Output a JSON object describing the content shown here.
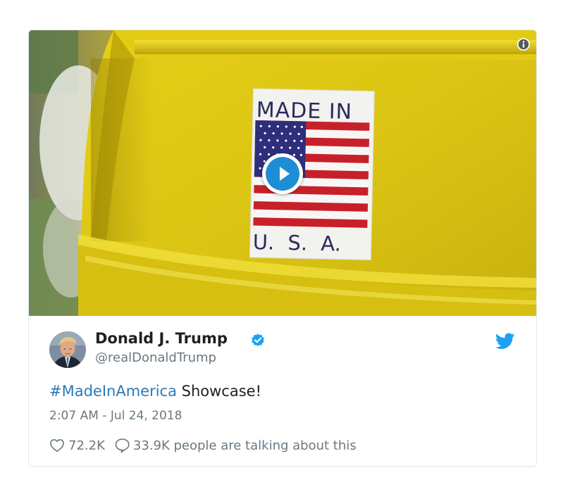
{
  "media": {
    "sticker_top": "MADE IN",
    "sticker_bottom": "U. S. A.",
    "play_icon": "play-icon",
    "info_icon": "info-icon"
  },
  "author": {
    "name": "Donald J. Trump",
    "handle": "@realDonaldTrump",
    "verified": true
  },
  "tweet": {
    "hashtag": "#MadeInAmerica",
    "text": " Showcase!",
    "timestamp": "2:07 AM - Jul 24, 2018"
  },
  "actions": {
    "likes": "72.2K",
    "talking": "33.9K people are talking about this"
  },
  "colors": {
    "accent": "#1da1f2",
    "hashtag": "#2b7bb9",
    "muted": "#697882",
    "text": "#1c2022"
  }
}
